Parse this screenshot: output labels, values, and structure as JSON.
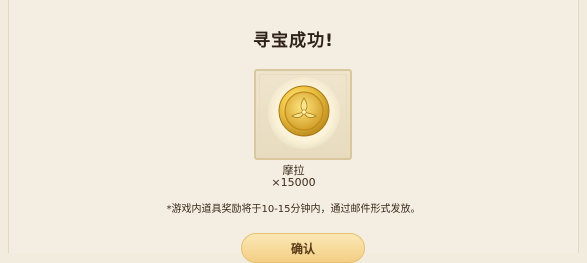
{
  "dialog": {
    "title": "寻宝成功!",
    "reward": {
      "icon": "gold-coin-icon",
      "name": "摩拉",
      "quantity": "×15000"
    },
    "notice": "*游戏内道具奖励将于10-15分钟内，通过邮件形式发放。",
    "confirm_label": "确认"
  },
  "colors": {
    "background": "#f2ecdf",
    "button_gradient_top": "#fbe7b4",
    "button_gradient_bottom": "#f3cf86",
    "coin_gold": "#e0b02a"
  }
}
